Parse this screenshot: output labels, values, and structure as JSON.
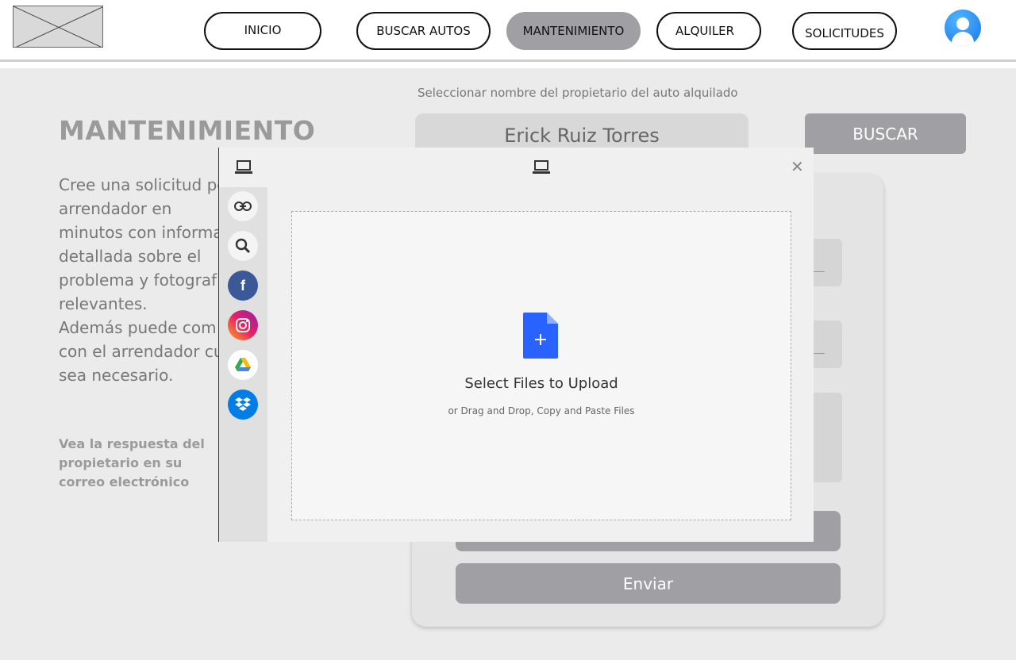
{
  "nav": {
    "items": [
      {
        "label": "INICIO"
      },
      {
        "label": "BUSCAR AUTOS"
      },
      {
        "label": "MANTENIMIENTO"
      },
      {
        "label": "ALQUILER"
      },
      {
        "label": "SOLICITUDES"
      }
    ],
    "active": "MANTENIMIENTO"
  },
  "page": {
    "title": "MANTENIMIENTO",
    "description": "Cree una solicitud po\n arrendador en\nminutos con informa\ndetallada sobre el\nproblema y fotograf\nrelevantes.\nAdemás puede com\ncon el arrendador cu\nsea necesario.",
    "note": "Vea la respuesta del propietario en su correo electrónico"
  },
  "owner_search": {
    "label": "Seleccionar  nombre del propietario del auto  alquilado",
    "value": "Erick Ruiz Torres",
    "button": "BUSCAR"
  },
  "form": {
    "submit_label": "Enviar"
  },
  "upload_dialog": {
    "title": "Select Files to Upload",
    "subtitle": "or Drag and Drop, Copy and Paste Files",
    "close": "✕",
    "sources": [
      "link-icon",
      "search-icon",
      "facebook-icon",
      "instagram-icon",
      "google-drive-icon",
      "dropbox-icon"
    ]
  },
  "colors": {
    "accent_gray": "#a09fa3",
    "file_icon_blue": "#2962ff"
  }
}
